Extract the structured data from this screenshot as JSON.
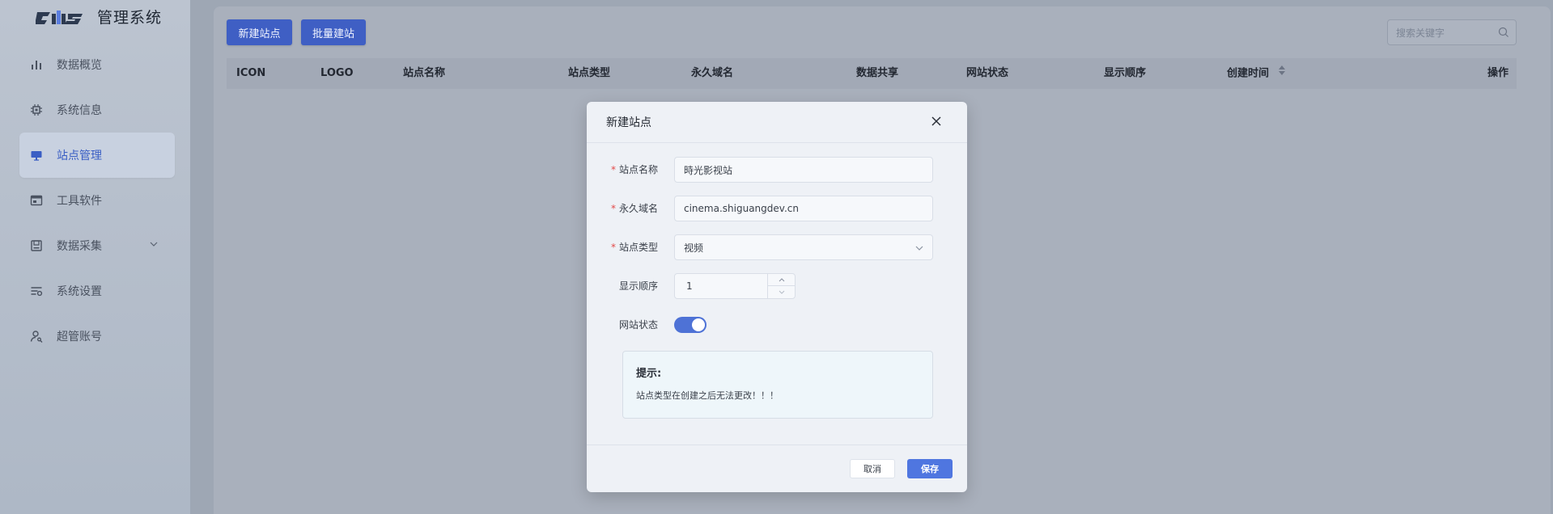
{
  "app": {
    "title": "管理系统",
    "logo_text": "cms"
  },
  "sidebar": {
    "items": [
      {
        "label": "数据概览",
        "icon": "bar-chart-icon"
      },
      {
        "label": "系统信息",
        "icon": "chip-icon"
      },
      {
        "label": "站点管理",
        "icon": "monitor-icon",
        "active": true
      },
      {
        "label": "工具软件",
        "icon": "window-icon"
      },
      {
        "label": "数据采集",
        "icon": "save-icon",
        "has_submenu": true
      },
      {
        "label": "系统设置",
        "icon": "sliders-icon"
      },
      {
        "label": "超管账号",
        "icon": "user-key-icon"
      }
    ]
  },
  "toolbar": {
    "new_site_label": "新建站点",
    "batch_create_label": "批量建站",
    "search_placeholder": "搜索关键字"
  },
  "table": {
    "columns": [
      "ICON",
      "LOGO",
      "站点名称",
      "站点类型",
      "永久域名",
      "数据共享",
      "网站状态",
      "显示顺序",
      "创建时间",
      "操作"
    ],
    "rows": []
  },
  "dialog": {
    "title": "新建站点",
    "fields": {
      "site_name": {
        "label": "站点名称",
        "value": "時光影视站",
        "required": true
      },
      "domain": {
        "label": "永久域名",
        "value": "cinema.shiguangdev.cn",
        "required": true
      },
      "site_type": {
        "label": "站点类型",
        "value": "视频",
        "required": true
      },
      "display_order": {
        "label": "显示顺序",
        "value": "1"
      },
      "site_status": {
        "label": "网站状态",
        "enabled": true
      }
    },
    "tip": {
      "title": "提示:",
      "text": "站点类型在创建之后无法更改！！！"
    },
    "cancel_label": "取消",
    "save_label": "保存"
  },
  "colors": {
    "primary": "#3f5fc4",
    "toggle_on": "#4e72d6",
    "required_mark": "#e24a4a",
    "active_nav_text": "#3a5ec4"
  }
}
